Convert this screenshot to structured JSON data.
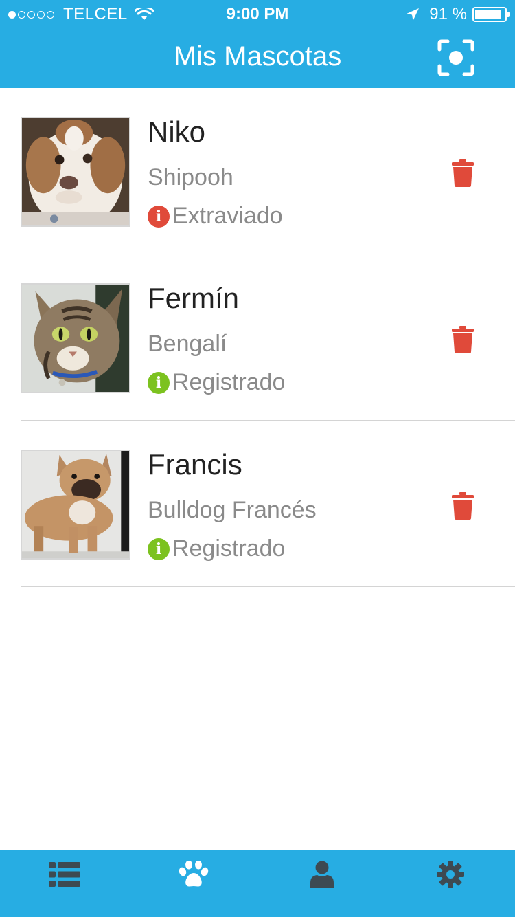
{
  "status_bar": {
    "carrier": "TELCEL",
    "time": "9:00 PM",
    "battery_percent": "91 %",
    "battery_level": 0.91,
    "signal_filled_dots": 1,
    "signal_total_dots": 5
  },
  "header": {
    "title": "Mis Mascotas",
    "scan_icon": "scan-qr-icon"
  },
  "pets": [
    {
      "name": "Niko",
      "breed": "Shipooh",
      "status": "Extraviado",
      "status_color": "#e04a3a",
      "photo": "white-brown-dog"
    },
    {
      "name": "Fermín",
      "breed": "Bengalí",
      "status": "Registrado",
      "status_color": "#7cc21f",
      "photo": "tabby-cat"
    },
    {
      "name": "Francis",
      "breed": "Bulldog Francés",
      "status": "Registrado",
      "status_color": "#7cc21f",
      "photo": "french-bulldog"
    }
  ],
  "tabbar": {
    "tabs": [
      {
        "icon": "list-icon",
        "active": false
      },
      {
        "icon": "paw-icon",
        "active": true
      },
      {
        "icon": "user-icon",
        "active": false
      },
      {
        "icon": "gear-icon",
        "active": false
      }
    ]
  },
  "colors": {
    "primary": "#27ade3",
    "danger": "#e04a3a",
    "success": "#7cc21f",
    "tab_inactive": "#3d4a52"
  }
}
